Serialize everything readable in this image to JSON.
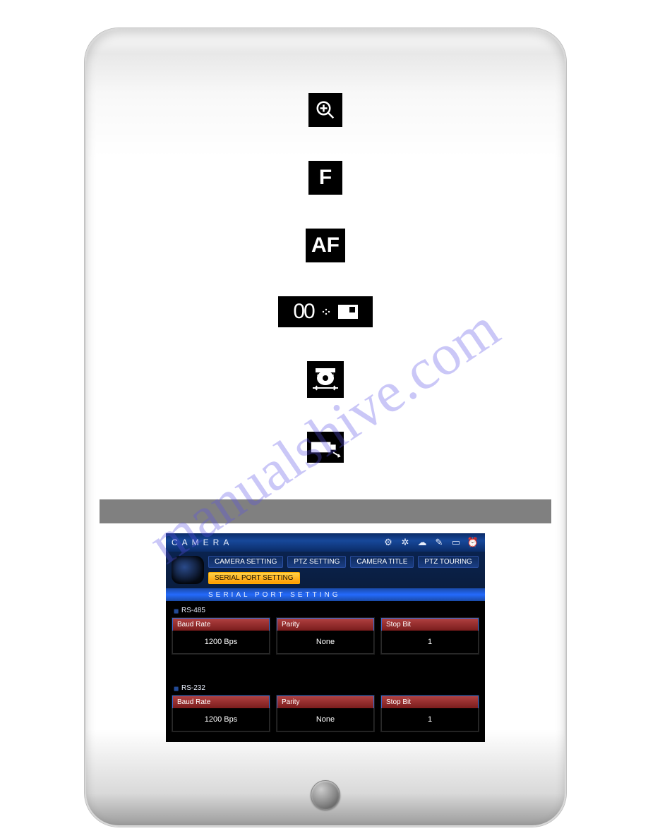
{
  "icons": {
    "zoom": "zoom-in",
    "f": "F",
    "af": "AF",
    "counter": "00",
    "dome": "dome-camera",
    "box_cam": "box-camera"
  },
  "watermark": "manualshive.com",
  "dvr": {
    "section": "CAMERA",
    "top_icons": [
      "gear",
      "reel",
      "cloud",
      "brush",
      "monitor",
      "alarm"
    ],
    "tabs": {
      "camera_setting": "CAMERA SETTING",
      "ptz_setting": "PTZ SETTING",
      "camera_title": "CAMERA TITLE",
      "ptz_touring": "PTZ TOURING",
      "serial_port_setting": "SERIAL PORT SETTING"
    },
    "subheading": "SERIAL PORT SETTING",
    "groups": [
      {
        "name": "RS-485",
        "fields": {
          "baud_label": "Baud Rate",
          "baud_value": "1200 Bps",
          "parity_label": "Parity",
          "parity_value": "None",
          "stop_label": "Stop Bit",
          "stop_value": "1"
        }
      },
      {
        "name": "RS-232",
        "fields": {
          "baud_label": "Baud Rate",
          "baud_value": "1200 Bps",
          "parity_label": "Parity",
          "parity_value": "None",
          "stop_label": "Stop Bit",
          "stop_value": "1"
        }
      }
    ]
  }
}
